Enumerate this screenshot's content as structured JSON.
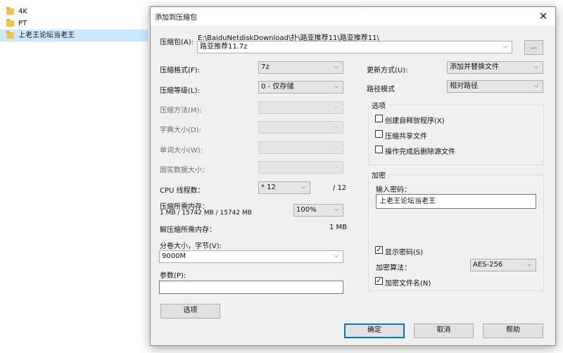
{
  "background": {
    "folders": [
      {
        "name": "4K",
        "selected": false
      },
      {
        "name": "PT",
        "selected": false
      },
      {
        "name": "上老王论坛当老王",
        "selected": true
      }
    ]
  },
  "dialog": {
    "title": "添加到压缩包",
    "close_glyph": "✕",
    "archive_label": "压缩包(A):",
    "archive_path": "E:\\BaiduNetdiskDownload\\扑\\路亚推荐11\\路亚推荐11\\",
    "archive_name": "路亚推荐11.7z",
    "browse_label": "...",
    "format_label": "压缩格式(F):",
    "format_value": "7z",
    "level_label": "压缩等级(L):",
    "level_value": "0 - 仅存储",
    "method_label": "压缩方法(M):",
    "dict_label": "字典大小(D):",
    "word_label": "单词大小(W):",
    "solid_label": "固实数据大小：",
    "cpu_label": "CPU 线程数：",
    "cpu_value": "* 12",
    "cpu_max": "/ 12",
    "mem_label": "压缩所需内存：",
    "mem_detail": "1 MB / 15742 MB / 15742 MB",
    "mem_percent": "100%",
    "decomp_label": "解压缩所需内存：",
    "decomp_value": "1 MB",
    "split_label": "分卷大小，字节(V):",
    "split_value": "9000M",
    "params_label": "参数(P):",
    "params_value": "",
    "options_button": "选项",
    "update_label": "更新方式(U):",
    "update_value": "添加并替换文件",
    "path_mode_label": "路径模式",
    "path_mode_value": "相对路径",
    "options_group": {
      "title": "选项",
      "items": [
        {
          "label": "创建自释放程序(X)",
          "checked": false
        },
        {
          "label": "压缩共享文件",
          "checked": false
        },
        {
          "label": "操作完成后删除源文件",
          "checked": false
        }
      ]
    },
    "encryption": {
      "title": "加密",
      "password_label": "输入密码：",
      "password_value": "上老王论坛当老王",
      "show_password_label": "显示密码(S)",
      "show_password_checked": true,
      "method_label": "加密算法：",
      "method_value": "AES-256",
      "encrypt_names_label": "加密文件名(N)",
      "encrypt_names_checked": true
    },
    "ok_button": "确定",
    "cancel_button": "取消",
    "help_button": "帮助"
  }
}
